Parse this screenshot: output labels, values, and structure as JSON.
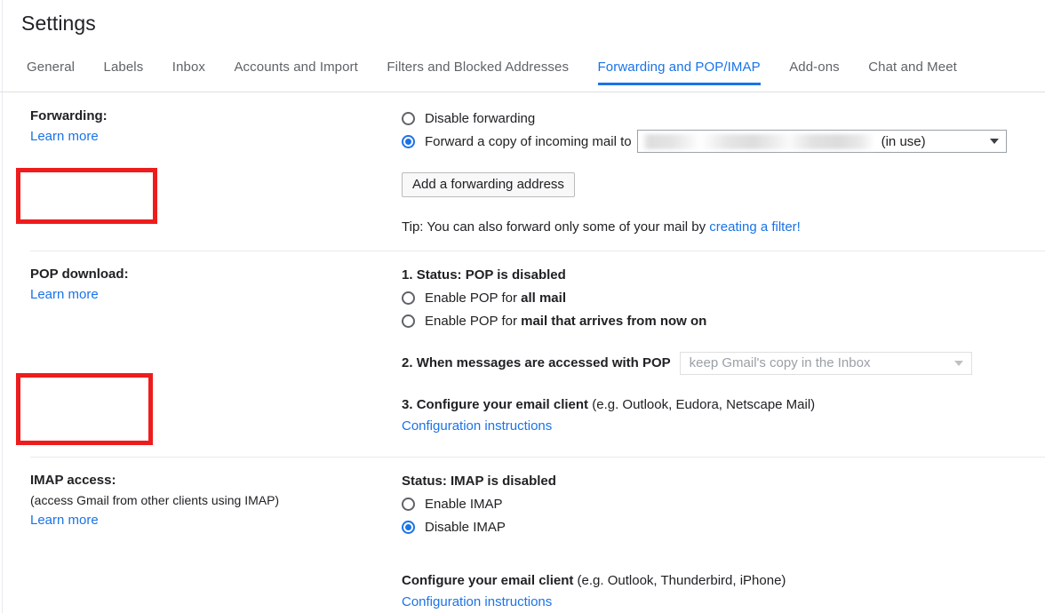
{
  "header": {
    "title": "Settings",
    "tabs": [
      {
        "label": "General",
        "active": false
      },
      {
        "label": "Labels",
        "active": false
      },
      {
        "label": "Inbox",
        "active": false
      },
      {
        "label": "Accounts and Import",
        "active": false
      },
      {
        "label": "Filters and Blocked Addresses",
        "active": false
      },
      {
        "label": "Forwarding and POP/IMAP",
        "active": true
      },
      {
        "label": "Add-ons",
        "active": false
      },
      {
        "label": "Chat and Meet",
        "active": false
      }
    ]
  },
  "colors": {
    "accent": "#1a73e8",
    "annotation": "#ee1c1c",
    "text": "#202124",
    "muted": "#5f6368"
  },
  "forwarding": {
    "label": "Forwarding:",
    "learn_more": "Learn more",
    "disable_option": "Disable forwarding",
    "forward_option": "Forward a copy of incoming mail to",
    "selected_address": "",
    "address_state": "(in use)",
    "add_address_button": "Add a forwarding address",
    "tip_prefix": "Tip: You can also forward only some of your mail by ",
    "tip_link": "creating a filter!"
  },
  "pop": {
    "label": "POP download:",
    "learn_more": "Learn more",
    "step1_number": "1.",
    "step1_status": "Status: POP is disabled",
    "enable_all_prefix": "Enable POP for ",
    "enable_all_bold": "all mail",
    "enable_new_prefix": "Enable POP for ",
    "enable_new_bold": "mail that arrives from now on",
    "step2_number": "2.",
    "step2_text": "When messages are accessed with POP",
    "step2_select_value": "keep Gmail's copy in the Inbox",
    "step3_number": "3.",
    "step3_bold": "Configure your email client",
    "step3_muted": " (e.g. Outlook, Eudora, Netscape Mail)",
    "config_link": "Configuration instructions"
  },
  "imap": {
    "label": "IMAP access:",
    "sublabel": "(access Gmail from other clients using IMAP)",
    "learn_more": "Learn more",
    "status": "Status: IMAP is disabled",
    "enable_option": "Enable IMAP",
    "disable_option": "Disable IMAP",
    "configure_bold": "Configure your email client",
    "configure_muted": " (e.g. Outlook, Thunderbird, iPhone)",
    "config_link": "Configuration instructions"
  }
}
